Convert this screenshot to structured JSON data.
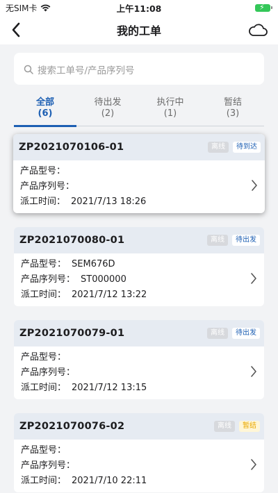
{
  "status_bar": {
    "carrier": "无SIM卡",
    "time": "上午11:08"
  },
  "nav": {
    "title": "我的工单"
  },
  "search": {
    "placeholder": "搜索工单号/产品序列号"
  },
  "tabs": [
    {
      "label": "全部",
      "count": "(6)"
    },
    {
      "label": "待出发",
      "count": "(2)"
    },
    {
      "label": "执行中",
      "count": "(1)"
    },
    {
      "label": "暂结",
      "count": "(3)"
    }
  ],
  "labels": {
    "model": "产品型号：",
    "serial": "产品序列号：",
    "dispatch": "派工时间："
  },
  "orders": [
    {
      "id": "ZP2021070106-01",
      "offline": "离线",
      "status": "待到达",
      "model": "",
      "serial": "",
      "time": "2021/7/13 18:26"
    },
    {
      "id": "ZP2021070080-01",
      "offline": "离线",
      "status": "待出发",
      "model": "SEM676D",
      "serial": "ST000000",
      "time": "2021/7/12 13:22"
    },
    {
      "id": "ZP2021070079-01",
      "offline": "离线",
      "status": "待出发",
      "model": "",
      "serial": "",
      "time": "2021/7/12 13:15"
    },
    {
      "id": "ZP2021070076-02",
      "offline": "离线",
      "status": "暂结",
      "model": "",
      "serial": "",
      "time": "2021/7/10 22:11"
    }
  ],
  "colors": {
    "accent": "#1d5fb3",
    "card_header": "#e6ebf2",
    "background": "#f2f3f5",
    "battery": "#34c759",
    "paused_badge_text": "#e8a800"
  }
}
